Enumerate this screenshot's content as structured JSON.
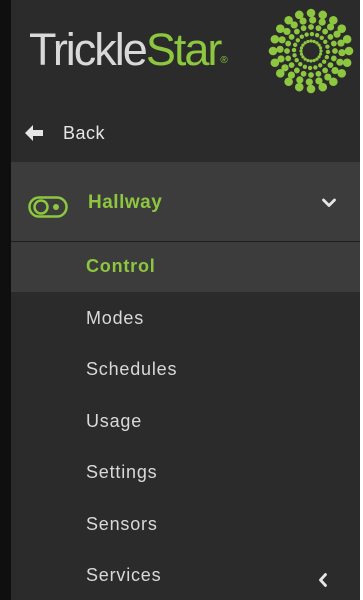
{
  "brand": {
    "name_part1": "Trickle",
    "name_part2": "Star",
    "trademark": "®",
    "accent_color": "#8dc63f",
    "logo_icon": "sunburst-icon"
  },
  "nav": {
    "back_label": "Back",
    "back_icon": "arrow-left-icon"
  },
  "device": {
    "name": "Hallway",
    "icon": "toggle-switch-icon",
    "expand_icon": "chevron-down-icon"
  },
  "menu": {
    "items": [
      {
        "label": "Control",
        "active": true
      },
      {
        "label": "Modes",
        "active": false
      },
      {
        "label": "Schedules",
        "active": false
      },
      {
        "label": "Usage",
        "active": false
      },
      {
        "label": "Settings",
        "active": false
      },
      {
        "label": "Sensors",
        "active": false
      },
      {
        "label": "Services",
        "active": false
      }
    ],
    "collapse_icon": "chevron-left-icon"
  }
}
